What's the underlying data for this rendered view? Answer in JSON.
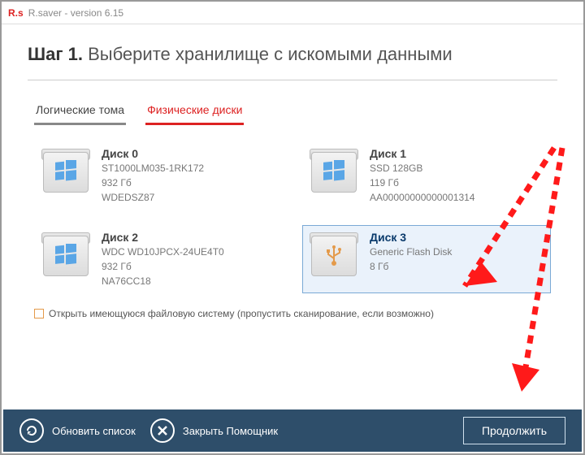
{
  "app": {
    "logo": "R.s",
    "title": "R.saver - version 6.15"
  },
  "header": {
    "step_bold": "Шаг 1.",
    "step_text": "Выберите хранилище с искомыми данными"
  },
  "tabs": {
    "logical": "Логические тома",
    "physical": "Физические диски",
    "active_index": 1
  },
  "disks": [
    {
      "name": "Диск 0",
      "model": "ST1000LM035-1RK172",
      "size": "932 Гб",
      "serial": "WDEDSZ87",
      "kind": "hdd",
      "selected": false
    },
    {
      "name": "Диск 1",
      "model": "SSD 128GB",
      "size": "119 Гб",
      "serial": "AA00000000000001314",
      "kind": "hdd",
      "selected": false
    },
    {
      "name": "Диск 2",
      "model": "WDC WD10JPCX-24UE4T0",
      "size": "932 Гб",
      "serial": "NA76CC18",
      "kind": "hdd",
      "selected": false
    },
    {
      "name": "Диск 3",
      "model": "Generic Flash Disk",
      "size": "8 Гб",
      "serial": "",
      "kind": "usb",
      "selected": true
    }
  ],
  "checkbox": {
    "label": "Открыть имеющуюся файловую систему (пропустить сканирование, если возможно)"
  },
  "footer": {
    "refresh": "Обновить список",
    "close": "Закрыть Помощник",
    "continue": "Продолжить"
  },
  "colors": {
    "accent": "#d22",
    "footer_bg": "#2e4e6a",
    "select_border": "#7aa9d6",
    "annotation": "#ff1a1a"
  }
}
